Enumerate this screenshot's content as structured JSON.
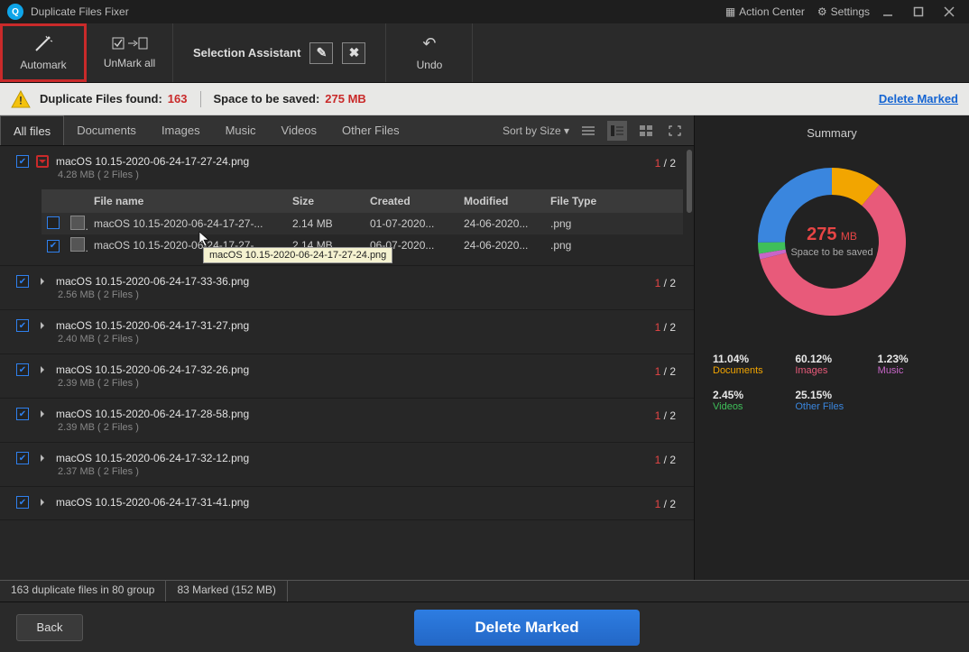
{
  "app": {
    "title": "Duplicate Files Fixer"
  },
  "titlebar": {
    "action_center": "Action Center",
    "settings": "Settings"
  },
  "toolbar": {
    "automark": "Automark",
    "unmark_all": "UnMark all",
    "selection_assistant": "Selection Assistant",
    "undo": "Undo"
  },
  "infobar": {
    "dup_found_label": "Duplicate Files found:",
    "dup_found_value": "163",
    "space_label": "Space to be saved:",
    "space_value": "275 MB",
    "delete_marked": "Delete Marked"
  },
  "filters": {
    "tabs": [
      "All files",
      "Documents",
      "Images",
      "Music",
      "Videos",
      "Other Files"
    ],
    "sort_label": "Sort by Size"
  },
  "table_headers": {
    "filename": "File name",
    "size": "Size",
    "created": "Created",
    "modified": "Modified",
    "filetype": "File Type"
  },
  "tooltip": "macOS 10.15-2020-06-24-17-27-24.png",
  "groups": [
    {
      "name": "macOS 10.15-2020-06-24-17-27-24.png",
      "size": "4.28 MB  ( 2 Files )",
      "marked": "1",
      "total": "2",
      "expanded": true,
      "highlight_caret": true,
      "rows": [
        {
          "checked": false,
          "name": "macOS 10.15-2020-06-24-17-27-...",
          "size": "2.14 MB",
          "created": "01-07-2020...",
          "modified": "24-06-2020...",
          "type": ".png"
        },
        {
          "checked": true,
          "name": "macOS 10.15-2020-06-24-17-27-...",
          "size": "2.14 MB",
          "created": "06-07-2020...",
          "modified": "24-06-2020...",
          "type": ".png"
        }
      ]
    },
    {
      "name": "macOS 10.15-2020-06-24-17-33-36.png",
      "size": "2.56 MB  ( 2 Files )",
      "marked": "1",
      "total": "2"
    },
    {
      "name": "macOS 10.15-2020-06-24-17-31-27.png",
      "size": "2.40 MB  ( 2 Files )",
      "marked": "1",
      "total": "2"
    },
    {
      "name": "macOS 10.15-2020-06-24-17-32-26.png",
      "size": "2.39 MB  ( 2 Files )",
      "marked": "1",
      "total": "2"
    },
    {
      "name": "macOS 10.15-2020-06-24-17-28-58.png",
      "size": "2.39 MB  ( 2 Files )",
      "marked": "1",
      "total": "2"
    },
    {
      "name": "macOS 10.15-2020-06-24-17-32-12.png",
      "size": "2.37 MB  ( 2 Files )",
      "marked": "1",
      "total": "2"
    },
    {
      "name": "macOS 10.15-2020-06-24-17-31-41.png",
      "size": "",
      "marked": "1",
      "total": "2"
    }
  ],
  "summary": {
    "title": "Summary",
    "center_value": "275",
    "center_unit": "MB",
    "center_sub": "Space to be saved",
    "legend": [
      {
        "pct": "11.04%",
        "label": "Documents",
        "cls": "lg-doc"
      },
      {
        "pct": "60.12%",
        "label": "Images",
        "cls": "lg-img"
      },
      {
        "pct": "1.23%",
        "label": "Music",
        "cls": "lg-mus"
      },
      {
        "pct": "2.45%",
        "label": "Videos",
        "cls": "lg-vid"
      },
      {
        "pct": "25.15%",
        "label": "Other Files",
        "cls": "lg-oth"
      }
    ]
  },
  "statusbar": {
    "left": "163 duplicate files in 80 group",
    "right": "83 Marked (152 MB)"
  },
  "bottom": {
    "back": "Back",
    "delete_marked": "Delete Marked"
  },
  "chart_data": {
    "type": "pie",
    "title": "275 MB — Space to be saved",
    "series": [
      {
        "name": "Documents",
        "value": 11.04,
        "color": "#f2a500"
      },
      {
        "name": "Images",
        "value": 60.12,
        "color": "#e85a7a"
      },
      {
        "name": "Music",
        "value": 1.23,
        "color": "#c766c7"
      },
      {
        "name": "Videos",
        "value": 2.45,
        "color": "#3fbf5a"
      },
      {
        "name": "Other Files",
        "value": 25.15,
        "color": "#3a86de"
      }
    ]
  }
}
